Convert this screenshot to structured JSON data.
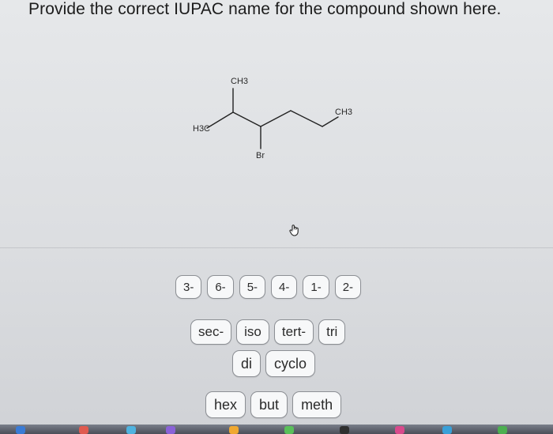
{
  "question": {
    "text": "Provide the correct IUPAC name for the compound shown here."
  },
  "molecule": {
    "labels": {
      "top_methyl": "CH3",
      "left_methyl": "H3C",
      "right_methyl": "CH3",
      "substituent": "Br"
    }
  },
  "options": {
    "locants": [
      "3-",
      "6-",
      "5-",
      "4-",
      "1-",
      "2-"
    ],
    "prefixes": [
      "sec-",
      "iso",
      "tert-",
      "tri"
    ],
    "multipliers": [
      "di",
      "cyclo"
    ],
    "roots": [
      "hex",
      "but",
      "meth"
    ]
  },
  "colors": {
    "chip_border": "#8c8f94",
    "chip_fill": "#f7f8f9",
    "text": "#1c1c1c"
  }
}
